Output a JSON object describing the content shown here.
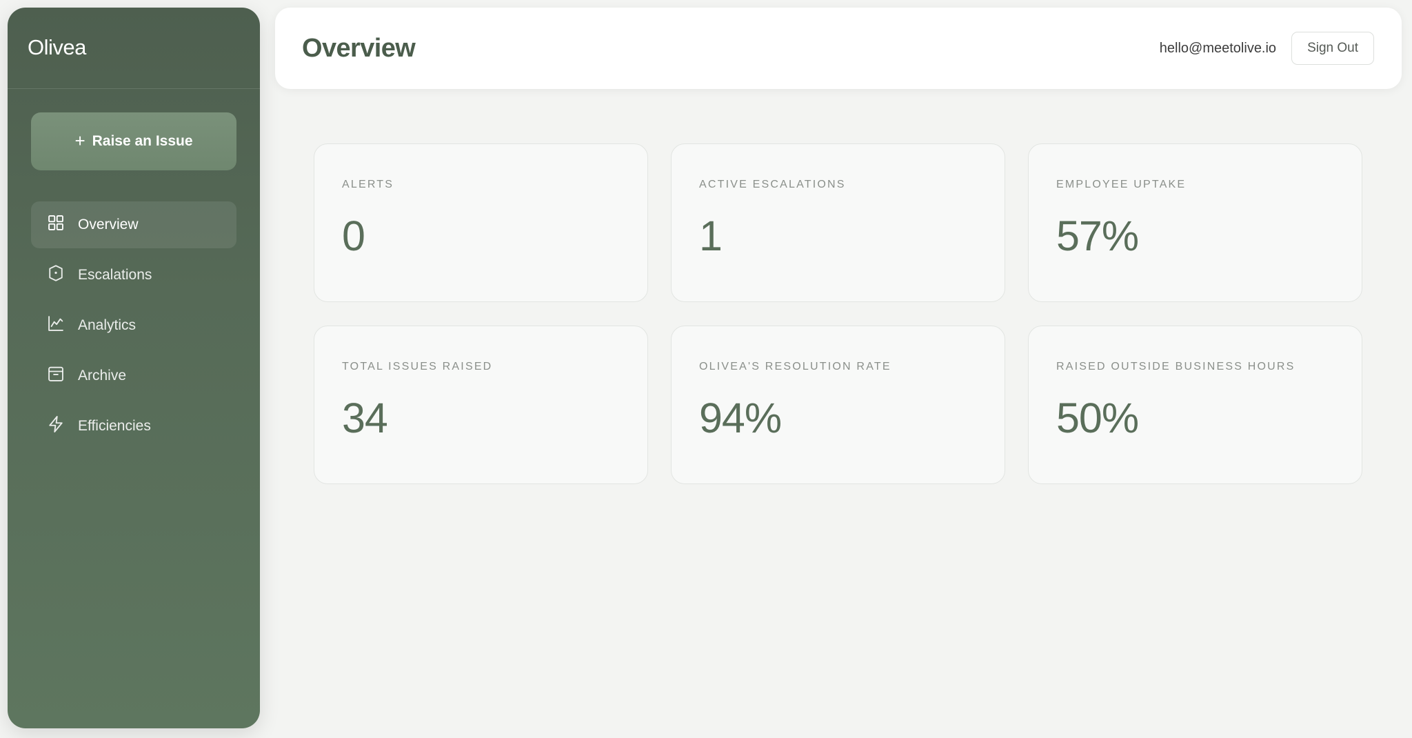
{
  "app": {
    "brand": "Olivea"
  },
  "sidebar": {
    "raise_button": {
      "icon": "plus-icon",
      "label": "Raise an Issue"
    },
    "items": [
      {
        "label": "Overview",
        "icon": "grid-icon",
        "active": true
      },
      {
        "label": "Escalations",
        "icon": "shield-icon",
        "active": false
      },
      {
        "label": "Analytics",
        "icon": "line-chart-icon",
        "active": false
      },
      {
        "label": "Archive",
        "icon": "archive-icon",
        "active": false
      },
      {
        "label": "Efficiencies",
        "icon": "lightning-icon",
        "active": false
      }
    ]
  },
  "header": {
    "title": "Overview",
    "user_email": "hello@meetolive.io",
    "sign_out_label": "Sign Out"
  },
  "stats": [
    {
      "label": "ALERTS",
      "value": "0"
    },
    {
      "label": "ACTIVE ESCALATIONS",
      "value": "1"
    },
    {
      "label": "EMPLOYEE UPTAKE",
      "value": "57%"
    },
    {
      "label": "TOTAL ISSUES RAISED",
      "value": "34"
    },
    {
      "label": "OLIVEA'S RESOLUTION RATE",
      "value": "94%"
    },
    {
      "label": "RAISED OUTSIDE BUSINESS HOURS",
      "value": "50%"
    }
  ],
  "colors": {
    "sidebar_green": "#566a57",
    "accent_green": "#5a6e5a",
    "page_background": "#f3f4f2"
  }
}
